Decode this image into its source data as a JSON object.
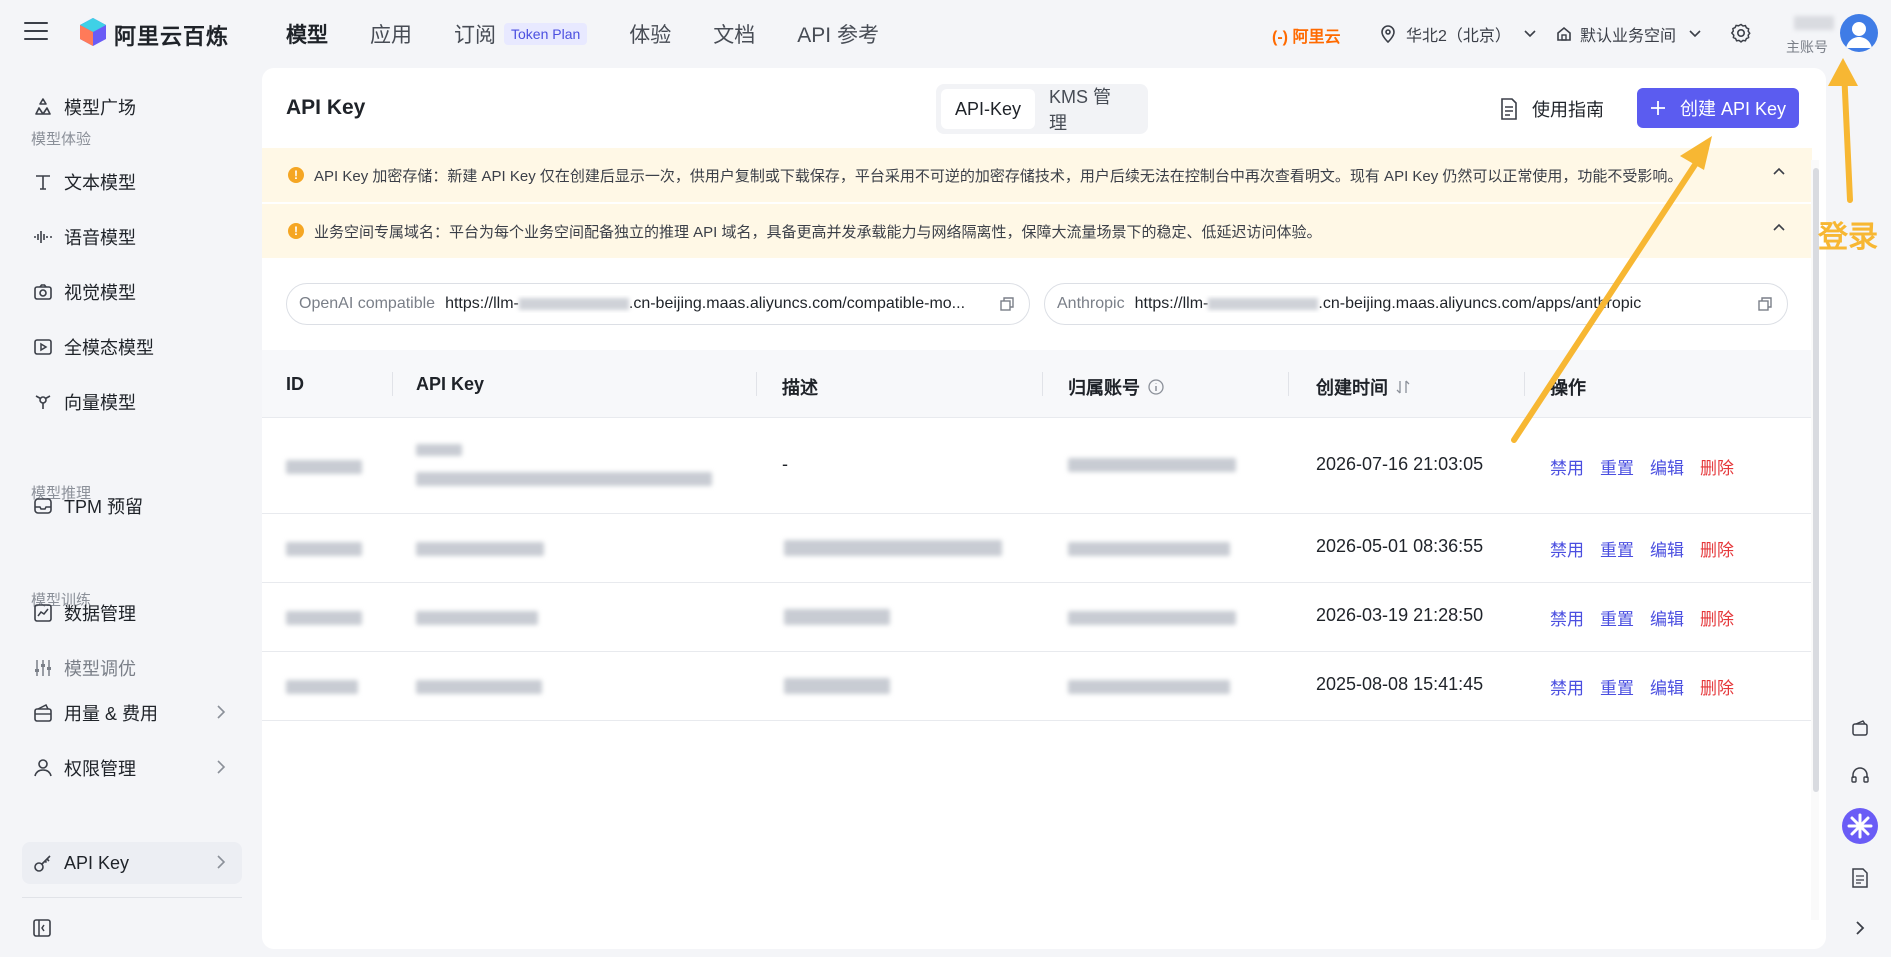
{
  "brand": {
    "name": "阿里云百炼"
  },
  "topnav": [
    {
      "label": "模型",
      "active": true
    },
    {
      "label": "应用"
    },
    {
      "label": "订阅",
      "badge": "Token Plan"
    },
    {
      "label": "体验"
    },
    {
      "label": "文档"
    },
    {
      "label": "API 参考"
    }
  ],
  "header": {
    "aliyun": "阿里云",
    "region": "华北2（北京）",
    "workspace": "默认业务空间",
    "user_sub": "主账号"
  },
  "sidebar": {
    "items": [
      {
        "label": "模型广场",
        "icon": "model-square-icon"
      },
      {
        "group": "模型体验"
      },
      {
        "label": "文本模型",
        "icon": "text-icon"
      },
      {
        "label": "语音模型",
        "icon": "audio-wave-icon"
      },
      {
        "label": "视觉模型",
        "icon": "camera-icon"
      },
      {
        "label": "全模态模型",
        "icon": "video-icon"
      },
      {
        "label": "向量模型",
        "icon": "vector-icon"
      },
      {
        "group": "模型推理"
      },
      {
        "label": "TPM 预留",
        "icon": "tpm-icon"
      },
      {
        "group": "模型训练"
      },
      {
        "label": "数据管理",
        "icon": "data-icon"
      },
      {
        "label": "模型调优",
        "icon": "tune-icon"
      },
      {
        "label": "用量 & 费用",
        "icon": "wallet-icon"
      },
      {
        "label": "权限管理",
        "icon": "user-icon"
      },
      {
        "label": "API Key",
        "icon": "key-icon"
      }
    ]
  },
  "page": {
    "title": "API Key",
    "tabs": [
      "API-Key",
      "KMS 管理"
    ],
    "guide": "使用指南",
    "create": "创建 API Key"
  },
  "notices": [
    "API Key 加密存储：新建 API Key 仅在创建后显示一次，供用户复制或下载保存，平台采用不可逆的加密存储技术，用户后续无法在控制台中再次查看明文。现有 API Key 仍然可以正常使用，功能不受影响。",
    "业务空间专属域名：平台为每个业务空间配备独立的推理 API 域名，具备更高并发承载能力与网络隔离性，保障大流量场景下的稳定、低延迟访问体验。"
  ],
  "endpoints": {
    "openai_label": "OpenAI compatible",
    "openai_prefix": "https://llm-",
    "openai_suffix": ".cn-beijing.maas.aliyuncs.com/compatible-mo...",
    "anthropic_label": "Anthropic",
    "anthropic_prefix": "https://llm-",
    "anthropic_suffix": ".cn-beijing.maas.aliyuncs.com/apps/anthropic"
  },
  "table": {
    "columns": [
      "ID",
      "API Key",
      "描述",
      "归属账号",
      "创建时间",
      "操作"
    ],
    "rows": [
      {
        "desc": "-",
        "created": "2026-07-16 21:03:05"
      },
      {
        "desc": "",
        "created": "2026-05-01 08:36:55"
      },
      {
        "desc": "",
        "created": "2026-03-19 21:28:50"
      },
      {
        "desc": "",
        "created": "2025-08-08 15:41:45"
      }
    ],
    "actions": [
      "禁用",
      "重置",
      "编辑",
      "删除"
    ]
  },
  "annotation": {
    "label": "登录",
    "color": "#f7b733"
  },
  "colors": {
    "accent": "#5b5cf0",
    "danger": "#e5383b",
    "warning": "#f5a623",
    "notice_bg": "#fff8e6"
  }
}
